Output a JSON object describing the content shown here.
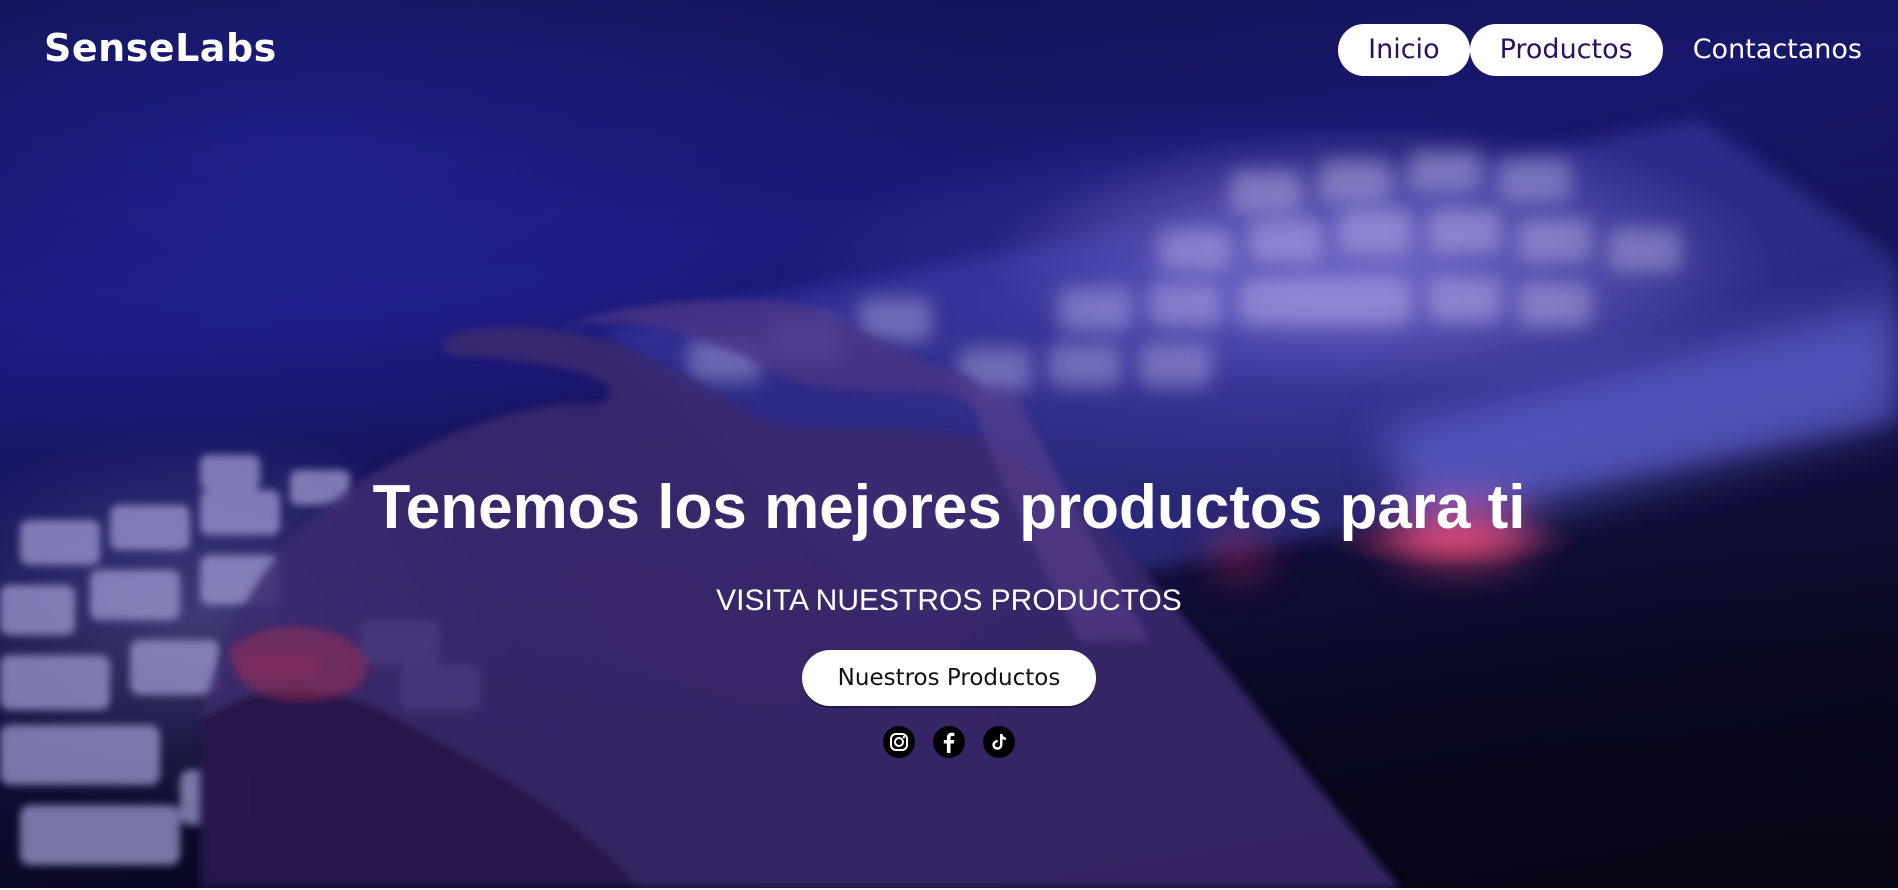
{
  "brand": {
    "logo_text": "SenseLabs"
  },
  "nav": {
    "items": [
      {
        "label": "Inicio"
      },
      {
        "label": "Productos"
      },
      {
        "label": "Contactanos"
      }
    ]
  },
  "hero": {
    "headline": "Tenemos los mejores productos para ti",
    "subheadline": "VISITA NUESTROS PRODUCTOS",
    "cta_label": "Nuestros Productos",
    "background_icon": "keyboard-photo"
  },
  "socials": [
    {
      "icon": "instagram-icon"
    },
    {
      "icon": "facebook-icon"
    },
    {
      "icon": "tiktok-icon"
    }
  ],
  "colors": {
    "nav_pill_bg": "#ffffff",
    "nav_pill_text": "#2a1260",
    "text": "#ffffff",
    "cta_bg": "#ffffff",
    "cta_text": "#111111",
    "social_bg": "#000000"
  }
}
